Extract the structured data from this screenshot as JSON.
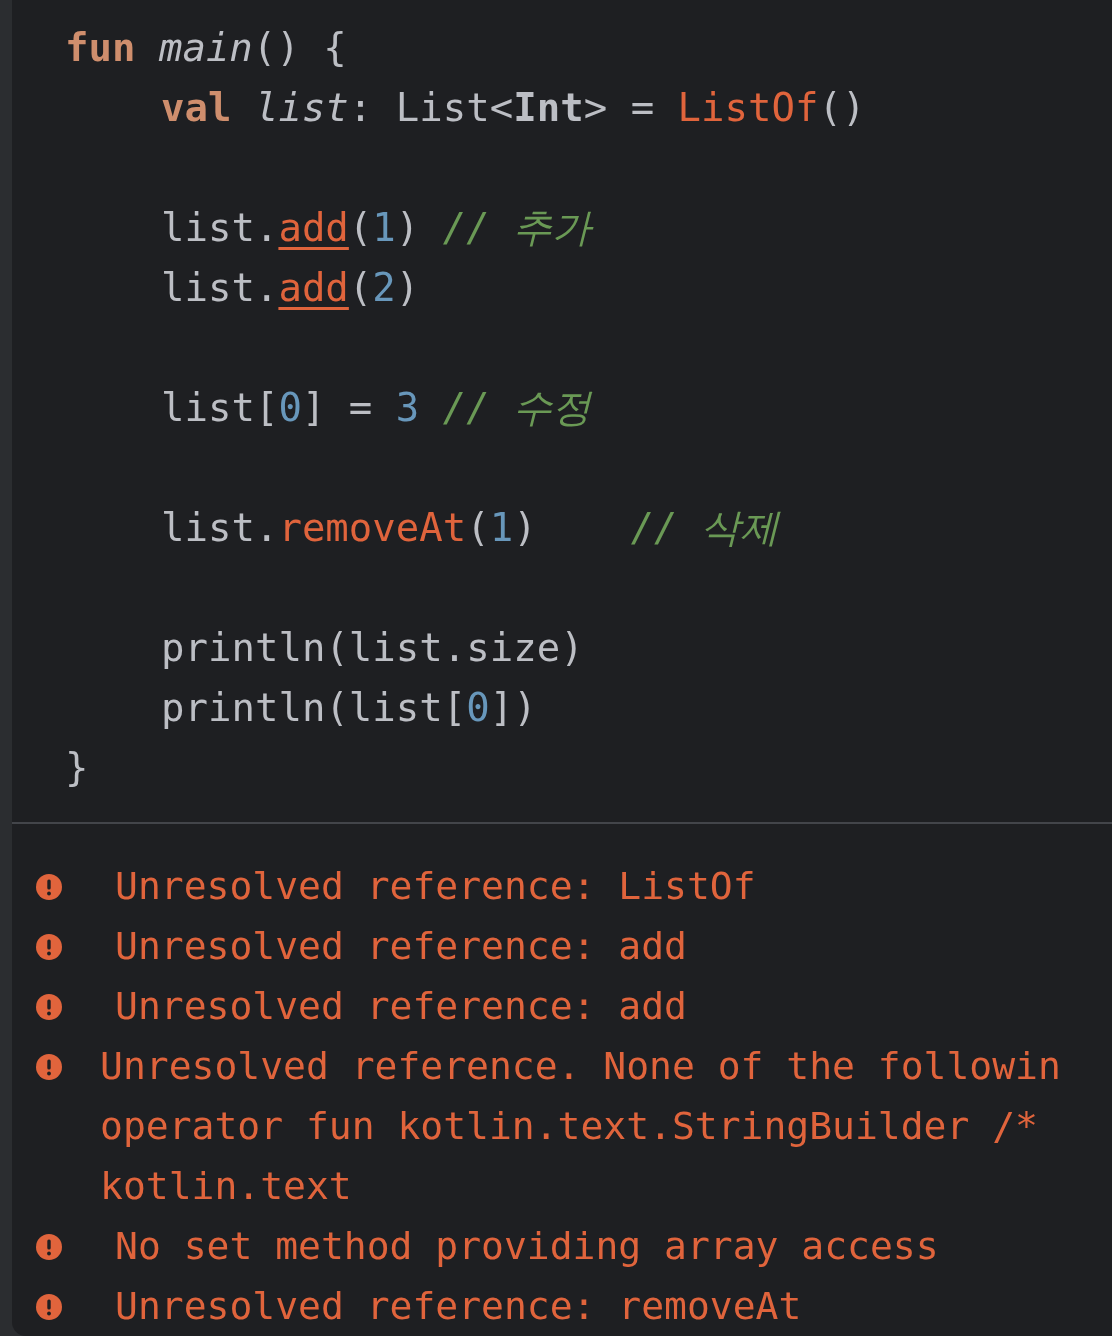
{
  "editor": {
    "lines": [
      {
        "kind": "code",
        "indent": false,
        "tokens": [
          {
            "text": "fun ",
            "kind": "keyword"
          },
          {
            "text": "main",
            "kind": "function"
          },
          {
            "text": "() {",
            "kind": "plain"
          }
        ]
      },
      {
        "kind": "code",
        "indent": true,
        "tokens": [
          {
            "text": "val ",
            "kind": "keyword"
          },
          {
            "text": "list",
            "kind": "variable"
          },
          {
            "text": ": List<",
            "kind": "plain"
          },
          {
            "text": "Int",
            "kind": "type"
          },
          {
            "text": "> = ",
            "kind": "plain"
          },
          {
            "text": "ListOf",
            "kind": "error"
          },
          {
            "text": "()",
            "kind": "plain"
          }
        ]
      },
      {
        "kind": "blank"
      },
      {
        "kind": "code",
        "indent": true,
        "tokens": [
          {
            "text": "list.",
            "kind": "plain"
          },
          {
            "text": "add",
            "kind": "error_underlined"
          },
          {
            "text": "(",
            "kind": "plain"
          },
          {
            "text": "1",
            "kind": "number"
          },
          {
            "text": ") ",
            "kind": "plain"
          },
          {
            "text": "// 추가",
            "kind": "comment"
          }
        ]
      },
      {
        "kind": "code",
        "indent": true,
        "tokens": [
          {
            "text": "list.",
            "kind": "plain"
          },
          {
            "text": "add",
            "kind": "error_underlined"
          },
          {
            "text": "(",
            "kind": "plain"
          },
          {
            "text": "2",
            "kind": "number"
          },
          {
            "text": ")",
            "kind": "plain"
          }
        ]
      },
      {
        "kind": "blank"
      },
      {
        "kind": "code",
        "indent": true,
        "tokens": [
          {
            "text": "list[",
            "kind": "plain"
          },
          {
            "text": "0",
            "kind": "number"
          },
          {
            "text": "] = ",
            "kind": "plain"
          },
          {
            "text": "3 ",
            "kind": "number"
          },
          {
            "text": "// 수정",
            "kind": "comment"
          }
        ]
      },
      {
        "kind": "blank"
      },
      {
        "kind": "code",
        "indent": true,
        "tokens": [
          {
            "text": "list.",
            "kind": "plain"
          },
          {
            "text": "removeAt",
            "kind": "error"
          },
          {
            "text": "(",
            "kind": "plain"
          },
          {
            "text": "1",
            "kind": "number"
          },
          {
            "text": ")    ",
            "kind": "plain"
          },
          {
            "text": "// 삭제",
            "kind": "comment"
          }
        ]
      },
      {
        "kind": "blank"
      },
      {
        "kind": "code",
        "indent": true,
        "tokens": [
          {
            "text": "println(list.size)",
            "kind": "plain"
          }
        ]
      },
      {
        "kind": "code",
        "indent": true,
        "tokens": [
          {
            "text": "println(list[",
            "kind": "plain"
          },
          {
            "text": "0",
            "kind": "number"
          },
          {
            "text": "])",
            "kind": "plain"
          }
        ]
      },
      {
        "kind": "code",
        "indent": false,
        "tokens": [
          {
            "text": "}",
            "kind": "plain"
          }
        ]
      }
    ]
  },
  "errors": [
    {
      "indented": true,
      "lines": [
        "Unresolved reference: ListOf"
      ]
    },
    {
      "indented": true,
      "lines": [
        "Unresolved reference: add"
      ]
    },
    {
      "indented": true,
      "lines": [
        "Unresolved reference: add"
      ]
    },
    {
      "indented": false,
      "lines": [
        "Unresolved reference. None of the followin",
        "operator fun kotlin.text.StringBuilder /*",
        "kotlin.text"
      ]
    },
    {
      "indented": true,
      "lines": [
        "No set method providing array access"
      ]
    },
    {
      "indented": true,
      "lines": [
        "Unresolved reference: removeAt"
      ]
    }
  ]
}
